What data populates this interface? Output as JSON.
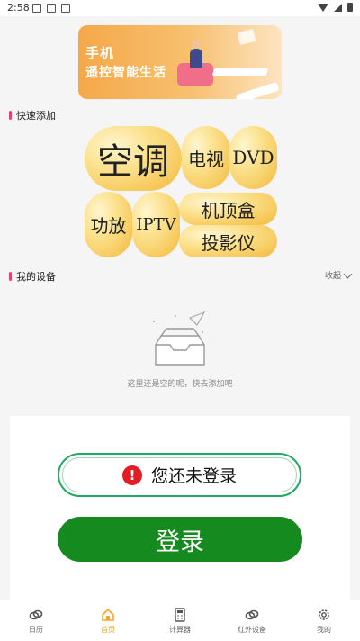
{
  "status_bar": {
    "time": "2:58"
  },
  "banner": {
    "line1": "手机",
    "line2": "遥控智能生活"
  },
  "quick_add": {
    "title": "快速添加",
    "devices": [
      "空调",
      "电视",
      "DVD",
      "功放",
      "IPTV",
      "机顶盒",
      "投影仪"
    ]
  },
  "my_devices": {
    "title": "我的设备",
    "collapse_label": "收起",
    "empty_text": "这里还是空的呢，快去添加吧"
  },
  "login_card": {
    "notice_icon": "!",
    "notice_text": "您还未登录",
    "login_button": "登录"
  },
  "tabs": [
    {
      "label": "日历",
      "icon": "link-icon"
    },
    {
      "label": "首页",
      "icon": "home-icon"
    },
    {
      "label": "计算器",
      "icon": "calculator-icon"
    },
    {
      "label": "红外设备",
      "icon": "link-icon"
    },
    {
      "label": "我的",
      "icon": "gear-icon"
    }
  ],
  "colors": {
    "accent": "#f5a623",
    "primary_green": "#148a1f",
    "alert_red": "#e51c23",
    "section_marker": "#e8436a"
  }
}
